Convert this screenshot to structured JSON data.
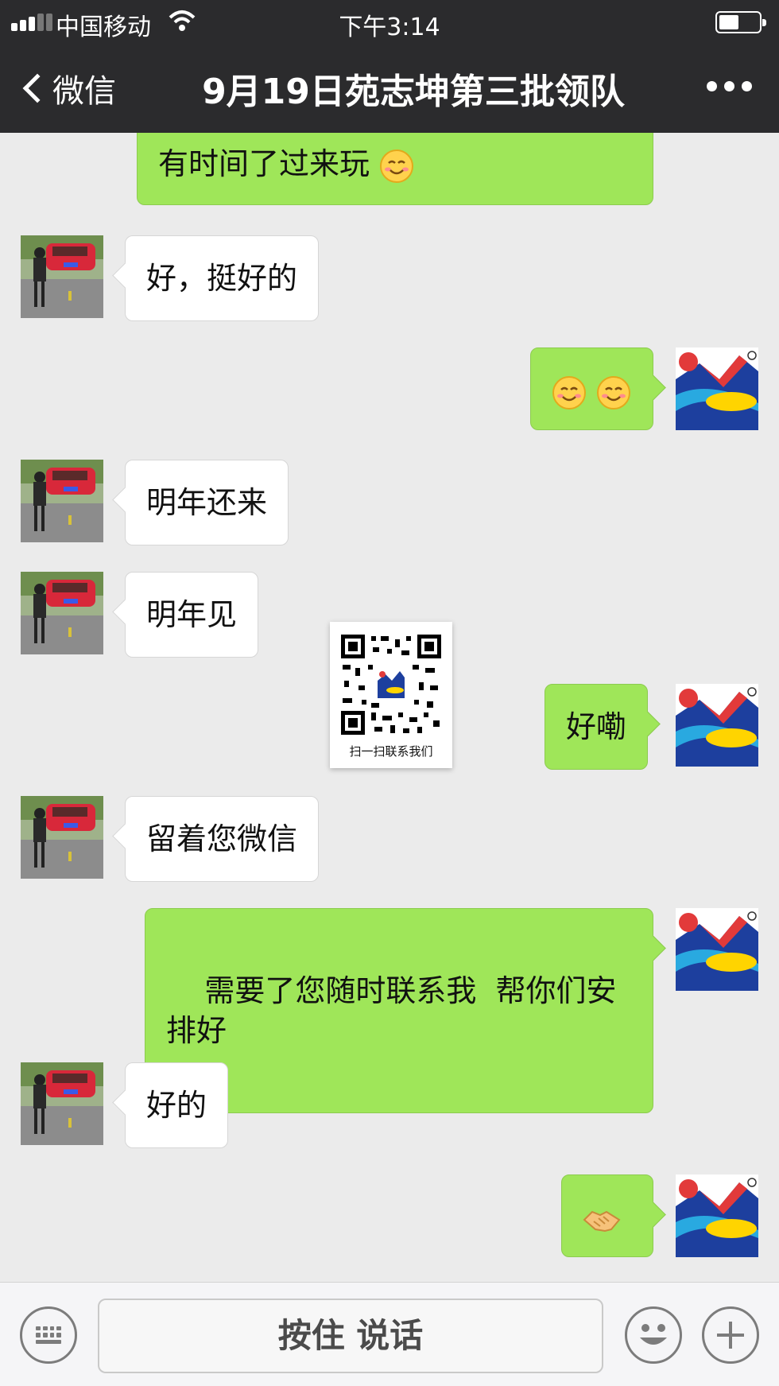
{
  "status_bar": {
    "carrier": "中国移动",
    "time": "下午3:14"
  },
  "nav": {
    "back_label": "微信",
    "title": "9月19日苑志坤第三批领队"
  },
  "messages": [
    {
      "side": "right",
      "text": "有时间了过来玩",
      "emoji": "smile"
    },
    {
      "side": "left",
      "text": "好，挺好的"
    },
    {
      "side": "right",
      "text": "",
      "emoji": "smile-smile"
    },
    {
      "side": "left",
      "text": "明年还来"
    },
    {
      "side": "left",
      "text": "明年见"
    },
    {
      "side": "right",
      "text": "好嘞"
    },
    {
      "side": "left",
      "text": "留着您微信"
    },
    {
      "side": "right",
      "text": "需要了您随时联系我  帮你们安排好"
    },
    {
      "side": "left",
      "text": "好的"
    },
    {
      "side": "right",
      "text": "",
      "emoji": "handshake"
    }
  ],
  "qr_card": {
    "caption": "扫一扫联系我们"
  },
  "input_bar": {
    "hold_to_talk": "按住 说话"
  },
  "colors": {
    "nav_bg": "#2b2b2d",
    "chat_bg": "#ebebeb",
    "bubble_me": "#9fe659",
    "bubble_other": "#ffffff"
  }
}
